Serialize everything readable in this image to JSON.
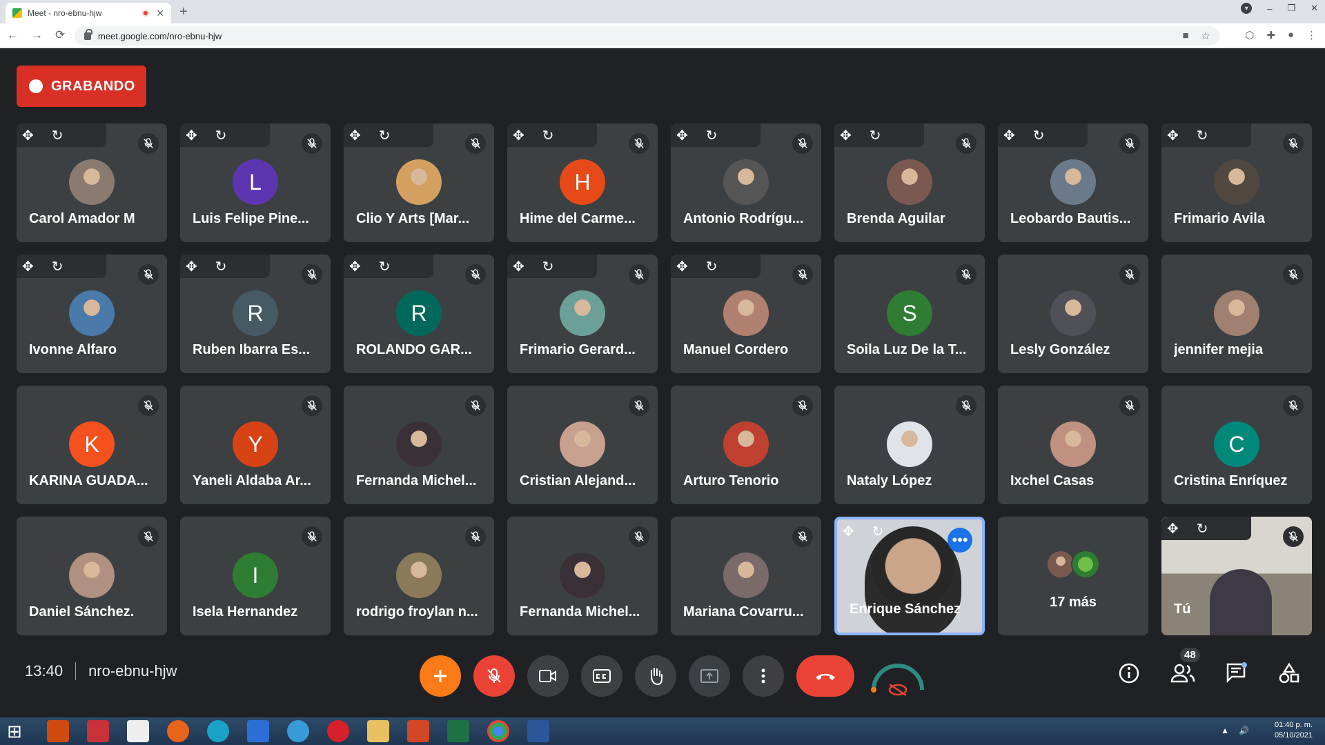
{
  "browser": {
    "tab_title": "Meet - nro-ebnu-hjw",
    "tab_close": "✕",
    "new_tab": "+",
    "url": "meet.google.com/nro-ebnu-hjw",
    "nav_back": "←",
    "nav_forward": "→",
    "nav_reload": "⟳",
    "window_min": "–",
    "window_max": "❐",
    "window_close": "✕"
  },
  "recording": {
    "label": "GRABANDO"
  },
  "participants": [
    {
      "name": "Carol Amador M",
      "avatar": "photo",
      "color": "#8a7a70"
    },
    {
      "name": "Luis Felipe Pine...",
      "initial": "L",
      "color": "#5e35b1"
    },
    {
      "name": "Clio Y Arts [Mar...",
      "avatar": "photo",
      "color": "#d4a060"
    },
    {
      "name": "Hime del Carme...",
      "initial": "H",
      "color": "#e64a19"
    },
    {
      "name": "Antonio Rodrígu...",
      "avatar": "photo",
      "color": "#555"
    },
    {
      "name": "Brenda Aguilar",
      "avatar": "photo",
      "color": "#7a5a50"
    },
    {
      "name": "Leobardo Bautis...",
      "avatar": "photo",
      "color": "#6a7a8a"
    },
    {
      "name": "Frimario Avila",
      "avatar": "photo",
      "color": "#504840"
    },
    {
      "name": "Ivonne Alfaro",
      "avatar": "photo",
      "color": "#4a7aaa"
    },
    {
      "name": "Ruben Ibarra Es...",
      "initial": "R",
      "color": "#455a64"
    },
    {
      "name": "ROLANDO GAR...",
      "initial": "R",
      "color": "#00695c"
    },
    {
      "name": "Frimario Gerard...",
      "avatar": "photo",
      "color": "#6aa098"
    },
    {
      "name": "Manuel Cordero",
      "avatar": "photo",
      "color": "#b08070"
    },
    {
      "name": "Soila Luz De la T...",
      "initial": "S",
      "color": "#2e7d32"
    },
    {
      "name": "Lesly González",
      "avatar": "photo",
      "color": "#505058"
    },
    {
      "name": "jennifer mejia",
      "avatar": "photo",
      "color": "#a08070"
    },
    {
      "name": "KARINA GUADA...",
      "initial": "K",
      "color": "#f4511e"
    },
    {
      "name": "Yaneli Aldaba Ar...",
      "initial": "Y",
      "color": "#d84315"
    },
    {
      "name": "Fernanda Michel...",
      "avatar": "photo",
      "color": "#3a3038"
    },
    {
      "name": "Cristian Alejand...",
      "avatar": "photo",
      "color": "#c8a090"
    },
    {
      "name": "Arturo Tenorio",
      "avatar": "photo",
      "color": "#c04030"
    },
    {
      "name": "Nataly López",
      "avatar": "photo",
      "color": "#e0e4e8"
    },
    {
      "name": "Ixchel Casas",
      "avatar": "photo",
      "color": "#c09080"
    },
    {
      "name": "Cristina Enríquez",
      "initial": "C",
      "color": "#00897b"
    },
    {
      "name": "Daniel Sánchez.",
      "avatar": "photo",
      "color": "#b09080"
    },
    {
      "name": "Isela Hernandez",
      "initial": "I",
      "color": "#2e7d32"
    },
    {
      "name": "rodrigo froylan n...",
      "avatar": "photo",
      "color": "#8a7a5a"
    },
    {
      "name": "Fernanda Michel...",
      "avatar": "photo",
      "color": "#3a3038"
    },
    {
      "name": "Mariana Covarru...",
      "avatar": "photo",
      "color": "#7a6a6a"
    }
  ],
  "active_speaker": {
    "name": "Enrique Sánchez",
    "more": "•••"
  },
  "more_tile": {
    "label": "17 más"
  },
  "self_tile": {
    "name": "Tú"
  },
  "meeting": {
    "time": "13:40",
    "code": "nro-ebnu-hjw"
  },
  "people_count": "48",
  "colors": {
    "recording": "#d93025",
    "hangup": "#ea4335",
    "accent": "#fa7b17",
    "active_border": "#8ab4f8"
  },
  "icons": [
    "move-icon",
    "refresh-icon",
    "mic-off-icon",
    "plus-icon",
    "camera-icon",
    "captions-icon",
    "raise-hand-icon",
    "present-icon",
    "more-vert-icon",
    "hang-up-icon",
    "info-icon",
    "people-icon",
    "chat-icon",
    "activities-icon"
  ],
  "taskbar": {
    "time": "01:40 p. m.",
    "date": "05/10/2021"
  }
}
